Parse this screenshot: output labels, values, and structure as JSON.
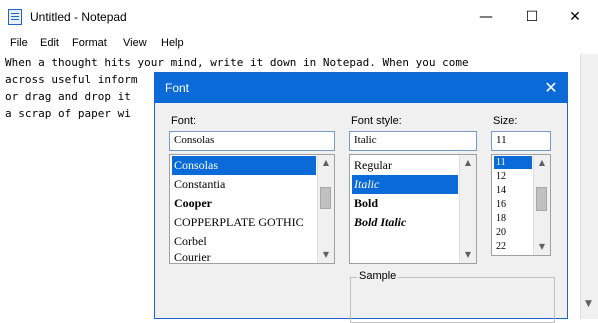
{
  "window": {
    "title": "Untitled - Notepad",
    "minimize_icon": "minimize-icon",
    "maximize_icon": "maximize-icon",
    "close_icon": "close-icon"
  },
  "menu": {
    "items": [
      {
        "label": "File"
      },
      {
        "label": "Edit"
      },
      {
        "label": "Format"
      },
      {
        "label": "View"
      },
      {
        "label": "Help"
      }
    ]
  },
  "editor": {
    "lines": [
      "When a thought hits your mind, write it down in Notepad. When you come",
      "across useful inform",
      "or drag and drop it",
      "a scrap of paper wi"
    ]
  },
  "font_dialog": {
    "title": "Font",
    "font": {
      "label": "Font:",
      "value": "Consolas",
      "items": [
        "Consolas",
        "Constantia",
        "Corbel",
        "Courier",
        "COPPERPLATE GOTHIC",
        "Corbel",
        "Courier"
      ],
      "selected_index": 0
    },
    "style": {
      "label": "Font style:",
      "value": "Italic",
      "items": [
        "Regular",
        "Italic",
        "Bold",
        "Bold Italic"
      ],
      "selected_index": 1
    },
    "size": {
      "label": "Size:",
      "value": "11",
      "items": [
        "11",
        "12",
        "14",
        "16",
        "18",
        "20",
        "22"
      ],
      "selected_index": 0
    },
    "sample_label": "Sample"
  },
  "colors": {
    "accent": "#0a6ad8",
    "dialog_bg": "#f0f0f0"
  }
}
